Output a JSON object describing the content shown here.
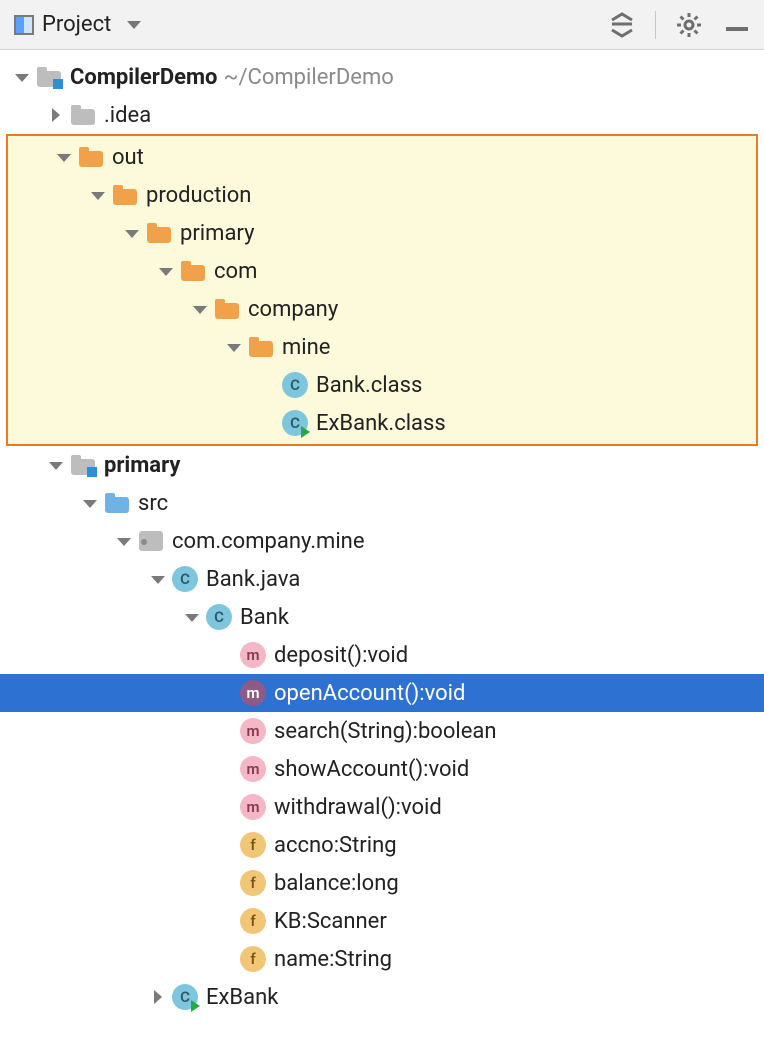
{
  "toolbar": {
    "title": "Project"
  },
  "tree": {
    "root": {
      "name": "CompilerDemo",
      "path": "~/CompilerDemo"
    },
    "idea": ".idea",
    "out": {
      "name": "out",
      "production": "production",
      "primary": "primary",
      "com": "com",
      "company": "company",
      "mine": "mine",
      "bank_class": "Bank.class",
      "exbank_class": "ExBank.class"
    },
    "primary": {
      "name": "primary",
      "src": "src",
      "pkg": "com.company.mine",
      "bank_java": "Bank.java",
      "bank_cls": "Bank",
      "exbank": "ExBank"
    },
    "members": {
      "deposit": "deposit():void",
      "openAccount": "openAccount():void",
      "search": "search(String):boolean",
      "showAccount": "showAccount():void",
      "withdrawal": "withdrawal():void",
      "accno": "accno:String",
      "balance": "balance:long",
      "kb": "KB:Scanner",
      "name_f": "name:String"
    }
  }
}
